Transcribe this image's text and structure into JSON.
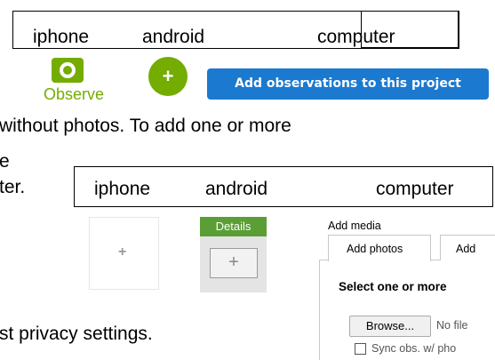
{
  "top_labels": {
    "iphone": "iphone",
    "android": "android",
    "computer": "computer"
  },
  "mid_labels": {
    "iphone": "iphone",
    "android": "android",
    "computer": "computer"
  },
  "observe": {
    "label": "Observe",
    "icon": "camera-icon",
    "color": "#74ac00"
  },
  "android_add": {
    "symbol": "+",
    "color": "#74ac00"
  },
  "add_obs_button": {
    "label": "Add observations to this project",
    "color": "#1b79cf"
  },
  "doc_text": {
    "line1": "without photos.  To add one or more",
    "line2": "e",
    "line3": "ter.",
    "line4": "st privacy settings."
  },
  "iphone_add": {
    "symbol": "+"
  },
  "details": {
    "header": "Details",
    "button": "+",
    "header_color": "#5a9e35"
  },
  "computer_media": {
    "heading": "Add media",
    "tab_active": "Add photos",
    "tab_other": "Add",
    "select_text": "Select one or more",
    "browse_label": "Browse...",
    "no_file": "No file",
    "sync_label": "Sync obs. w/ pho"
  }
}
